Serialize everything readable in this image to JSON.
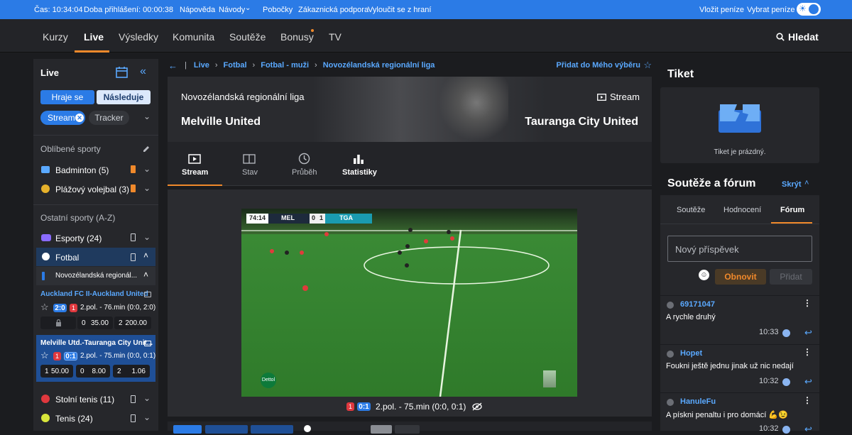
{
  "topbar": {
    "time": "Čas: 10:34:04",
    "login_time": "Doba přihlášení: 00:00:38",
    "links": [
      "Nápověda",
      "Návody",
      "Pobočky",
      "Zákaznická podpora",
      "Vyloučit se z hraní"
    ],
    "deposit": "Vložit peníze",
    "withdraw": "Vybrat peníze"
  },
  "nav": {
    "items": [
      "Kurzy",
      "Live",
      "Výsledky",
      "Komunita",
      "Soutěže",
      "Bonusy",
      "TV"
    ],
    "search": "Hledat"
  },
  "sidebar": {
    "title": "Live",
    "tab_playing": "Hraje se",
    "tab_next": "Následuje",
    "filter_stream": "Stream",
    "filter_tracker": "Tracker",
    "favorites_title": "Oblíbené sporty",
    "favorites": [
      "Badminton (5)",
      "Plážový volejbal (3)"
    ],
    "others_title": "Ostatní sporty (A-Z)",
    "esports": "Esporty (24)",
    "football": "Fotbal",
    "league": "Novozélandská regionál...",
    "match1": {
      "name": "Auckland FC II-Auckland United",
      "score": "2:0",
      "cards": "1",
      "status": "2.pol. - 76.min (0:0, 2:0)",
      "odds": [
        {
          "label": "0",
          "value": "35.00"
        },
        {
          "label": "2",
          "value": "200.00"
        }
      ]
    },
    "match2": {
      "name": "Melville Utd.-Tauranga City Unit...",
      "cards": "1",
      "score": "0:1",
      "status": "2.pol. - 75.min (0:0, 0:1)",
      "odds": [
        {
          "label": "1",
          "value": "50.00"
        },
        {
          "label": "0",
          "value": "8.00"
        },
        {
          "label": "2",
          "value": "1.06"
        }
      ]
    },
    "table_tennis": "Stolní tenis (11)",
    "tennis": "Tenis (24)"
  },
  "breadcrumb": {
    "items": [
      "Live",
      "Fotbal",
      "Fotbal - muži",
      "Novozélandská regionální liga"
    ],
    "add_fav": "Přidat do Mého výběru"
  },
  "match": {
    "league": "Novozélandská regionální liga",
    "stream_label": "Stream",
    "home": "Melville United",
    "away": "Tauranga City United",
    "tabs": [
      "Stream",
      "Stav",
      "Průběh",
      "Statistiky"
    ]
  },
  "video": {
    "clock": "74:14",
    "home_abbr": "MEL",
    "home_score": "0",
    "away_score": "1",
    "away_abbr": "TGA",
    "sponsor": "Dettol",
    "cards": "1",
    "score": "0:1",
    "status": "2.pol. - 75.min (0:0, 0:1)"
  },
  "ticket": {
    "title": "Tiket",
    "empty": "Tiket je prázdný."
  },
  "forum": {
    "title": "Soutěže a fórum",
    "hide": "Skrýt",
    "tabs": [
      "Soutěže",
      "Hodnocení",
      "Fórum"
    ],
    "placeholder": "Nový příspěvek",
    "refresh": "Obnovit",
    "add": "Přidat",
    "posts": [
      {
        "user": "69171047",
        "text": "A rychle druhý",
        "time": "10:33"
      },
      {
        "user": "Hopet",
        "text": "Foukni ještě jednu jinak už nic nedají",
        "time": "10:32"
      },
      {
        "user": "HanuleFu",
        "text": "A pískni penaltu i pro domácí 💪😉",
        "time": "10:32"
      }
    ]
  },
  "colors": {
    "accent": "#2b7be6",
    "active_tab": "#f0892b",
    "card_red": "#e0383e"
  }
}
